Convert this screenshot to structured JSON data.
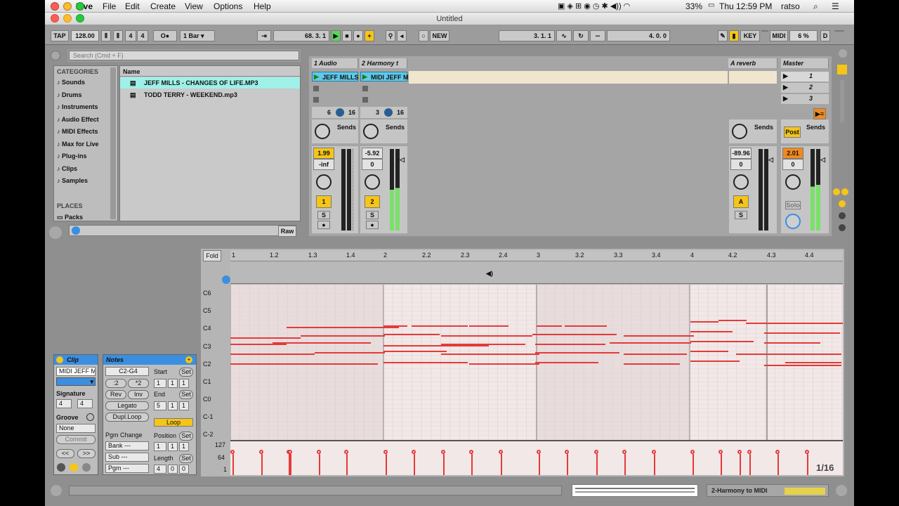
{
  "menubar": {
    "items": [
      "Live",
      "File",
      "Edit",
      "Create",
      "View",
      "Options",
      "Help"
    ],
    "battery": "33%",
    "clock": "Thu 12:59 PM",
    "user": "ratso"
  },
  "window": {
    "title": "Untitled"
  },
  "transport": {
    "tap": "TAP",
    "tempo": "128.00",
    "sig_num": "4",
    "sig_den": "4",
    "quantize": "1 Bar",
    "arrangement_pos": "68.  3.  1",
    "new_label": "NEW",
    "loop_start": "3.  1.  1",
    "loop_length": "4.  0.  0",
    "key_label": "KEY",
    "midi_label": "MIDI",
    "cpu": "6 %",
    "d_label": "D"
  },
  "browser": {
    "search_placeholder": "Search (Cmd + F)",
    "categories_header": "CATEGORIES",
    "categories": [
      "Sounds",
      "Drums",
      "Instruments",
      "Audio Effect",
      "MIDI Effects",
      "Max for Live",
      "Plug-ins",
      "Clips",
      "Samples"
    ],
    "places_header": "PLACES",
    "places": [
      "Packs"
    ],
    "name_header": "Name",
    "files": [
      "JEFF MILLS - CHANGES OF LIFE.MP3",
      "TODD TERRY - WEEKEND.mp3"
    ],
    "raw_label": "Raw"
  },
  "session": {
    "tracks": [
      {
        "name": "1 Audio",
        "clip": "JEFF MILLS",
        "in": "6",
        "out": "16",
        "volume": "1.99",
        "pan": "-inf",
        "number": "1",
        "solo": "S",
        "sends": "Sends"
      },
      {
        "name": "2 Harmony t",
        "clip": "MIDI JEFF M",
        "in": "3",
        "out": "16",
        "volume": "-5.92",
        "pan": "0",
        "number": "2",
        "solo": "S",
        "sends": "Sends"
      }
    ],
    "return": {
      "name": "A reverb",
      "volume": "-89.96",
      "pan": "0",
      "letter": "A",
      "solo": "S",
      "sends": "Sends"
    },
    "master": {
      "name": "Master",
      "scenes": [
        "1",
        "2",
        "3"
      ],
      "volume": "2.01",
      "pan": "0",
      "post": "Post",
      "solo": "Solo",
      "sends": "Sends"
    }
  },
  "clip_view": {
    "clip_header": "Clip",
    "clip_name": "MIDI JEFF M",
    "signature_label": "Signature",
    "sig_num": "4",
    "sig_den": "4",
    "groove_label": "Groove",
    "groove_value": "None",
    "commit": "Commit",
    "nav_left": "<<",
    "nav_right": ">>",
    "notes_header": "Notes",
    "range": "C2-G4",
    "half": ":2",
    "double": "*2",
    "rev": "Rev",
    "inv": "Inv",
    "legato": "Legato",
    "dupl_loop": "Dupl.Loop",
    "pgm_change": "Pgm Change",
    "bank": "Bank ---",
    "sub": "Sub ---",
    "pgm": "Pgm ---",
    "start_label": "Start",
    "start": [
      "1",
      "1",
      "1"
    ],
    "end_label": "End",
    "end": [
      "5",
      "1",
      "1"
    ],
    "loop": "Loop",
    "position_label": "Position",
    "position": [
      "1",
      "1",
      "1"
    ],
    "length_label": "Length",
    "length": [
      "4",
      "0",
      "0"
    ],
    "set": "Set"
  },
  "editor": {
    "fold": "Fold",
    "ruler": [
      "1",
      "1.2",
      "1.3",
      "1.4",
      "2",
      "2.2",
      "2.3",
      "2.4",
      "3",
      "3.2",
      "3.3",
      "3.4",
      "4",
      "4.2",
      "4.3",
      "4.4"
    ],
    "keys": [
      "C6",
      "C5",
      "C4",
      "C3",
      "C2",
      "C1",
      "C0",
      "C-1",
      "C-2"
    ],
    "vel_labels": [
      "127",
      "64",
      "1"
    ],
    "grid": "1/16"
  },
  "status": {
    "track_label": "2-Harmony to MIDI"
  },
  "colors": {
    "accent_yellow": "#f5c518",
    "clip_cyan": "#5fc9e8",
    "note_red": "#e53a3a",
    "browser_highlight": "#9ff0e8"
  }
}
